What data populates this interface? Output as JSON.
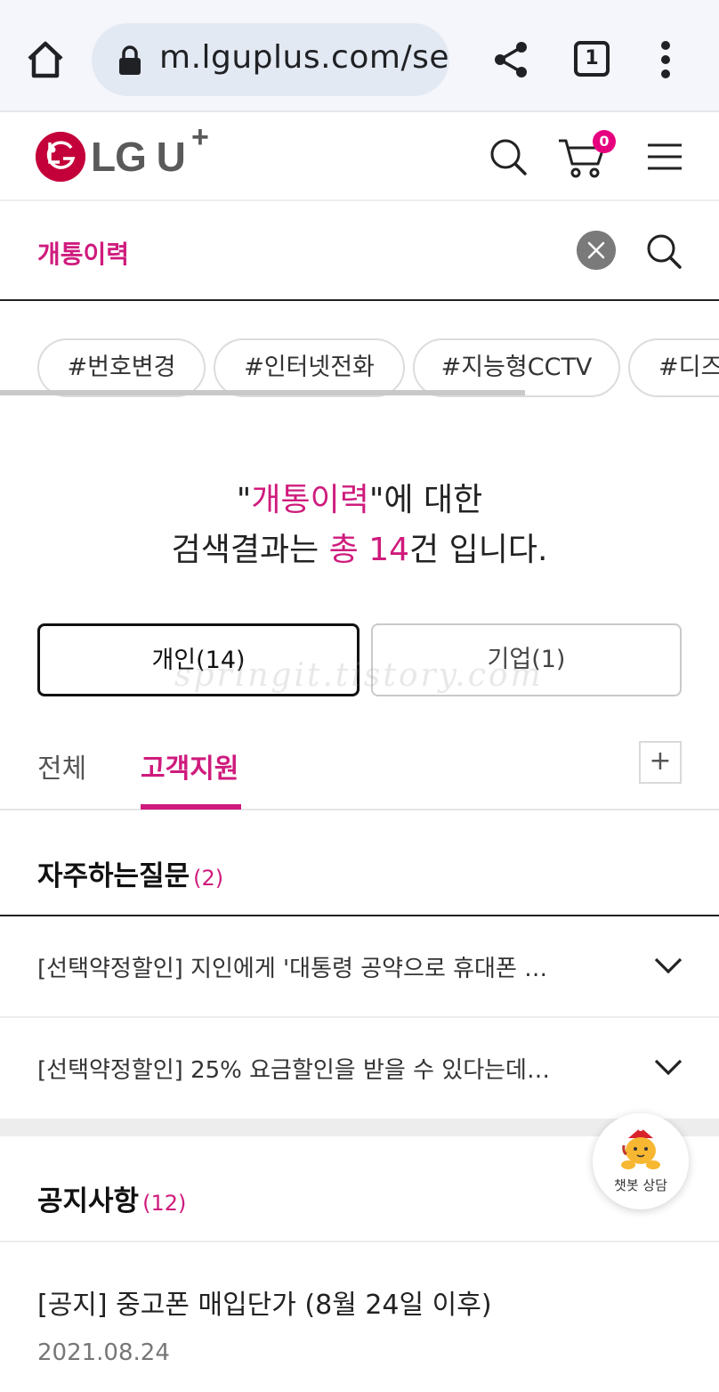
{
  "browser": {
    "url": "m.lguplus.com/search",
    "tab_count": "1"
  },
  "header": {
    "logo_text": "LG U",
    "logo_plus": "+",
    "cart_count": "0"
  },
  "search": {
    "query": "개통이력"
  },
  "hashtags": [
    "#번호변경",
    "#인터넷전화",
    "#지능형CCTV",
    "#디즈"
  ],
  "summary": {
    "quote_open": "\"",
    "query": "개통이력",
    "line1_suffix": "\"에 대한",
    "line2_prefix": "검색결과는 ",
    "total_label": "총 14",
    "line2_suffix": "건 입니다."
  },
  "segments": {
    "personal": "개인(14)",
    "business": "기업(1)"
  },
  "watermark": "springit.tistory.com",
  "tabs": {
    "all": "전체",
    "support": "고객지원",
    "plus": "+"
  },
  "faq": {
    "title": "자주하는질문",
    "count": "(2)",
    "items": [
      "[선택약정할인] 지인에게 '대통령 공약으로 휴대폰 …",
      "[선택약정할인] 25% 요금할인을 받을 수 있다는데…"
    ]
  },
  "notice": {
    "title": "공지사항",
    "count": "(12)",
    "items": [
      {
        "title": "[공지] 중고폰 매입단가 (8월 24일 이후)",
        "date": "2021.08.24"
      }
    ]
  },
  "chatbot": {
    "label": "챗봇 상담"
  },
  "colors": {
    "accent": "#cf1b7d",
    "badge": "#e6007e",
    "logo_red": "#c4003a"
  }
}
